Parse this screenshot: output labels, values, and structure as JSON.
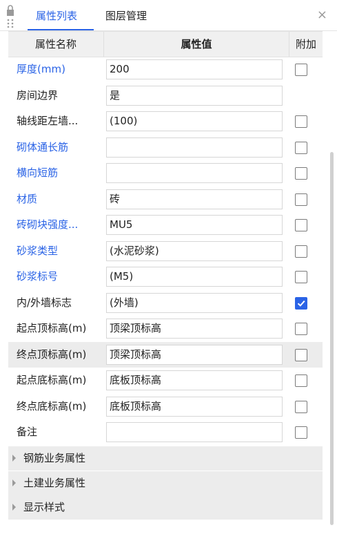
{
  "tabs": {
    "active": "属性列表",
    "inactive": "图层管理",
    "close": "×"
  },
  "header": {
    "name": "属性名称",
    "value": "属性值",
    "extra": "附加"
  },
  "rows": [
    {
      "name": "厚度(mm)",
      "value": "200",
      "blue": true,
      "checkbox": true,
      "checked": false
    },
    {
      "name": "房间边界",
      "value": "是",
      "blue": false,
      "checkbox": false,
      "checked": false
    },
    {
      "name": "轴线距左墙...",
      "value": "(100)",
      "blue": false,
      "checkbox": true,
      "checked": false
    },
    {
      "name": "砌体通长筋",
      "value": "",
      "blue": true,
      "checkbox": true,
      "checked": false
    },
    {
      "name": "横向短筋",
      "value": "",
      "blue": true,
      "checkbox": true,
      "checked": false
    },
    {
      "name": "材质",
      "value": "砖",
      "blue": true,
      "checkbox": true,
      "checked": false
    },
    {
      "name": "砖砌块强度...",
      "value": "MU5",
      "blue": true,
      "checkbox": true,
      "checked": false
    },
    {
      "name": "砂浆类型",
      "value": "(水泥砂浆)",
      "blue": true,
      "checkbox": true,
      "checked": false
    },
    {
      "name": "砂浆标号",
      "value": "(M5)",
      "blue": true,
      "checkbox": true,
      "checked": false
    },
    {
      "name": "内/外墙标志",
      "value": "(外墙)",
      "blue": false,
      "checkbox": true,
      "checked": true
    },
    {
      "name": "起点顶标高(m)",
      "value": "顶梁顶标高",
      "blue": false,
      "checkbox": true,
      "checked": false
    },
    {
      "name": "终点顶标高(m)",
      "value": "顶梁顶标高",
      "blue": false,
      "checkbox": true,
      "checked": false,
      "highlight": true
    },
    {
      "name": "起点底标高(m)",
      "value": "底板顶标高",
      "blue": false,
      "checkbox": true,
      "checked": false
    },
    {
      "name": "终点底标高(m)",
      "value": "底板顶标高",
      "blue": false,
      "checkbox": true,
      "checked": false
    },
    {
      "name": "备注",
      "value": "",
      "blue": false,
      "checkbox": true,
      "checked": false
    }
  ],
  "groups": [
    "钢筋业务属性",
    "土建业务属性",
    "显示样式"
  ],
  "colors": {
    "accent": "#2a63e6",
    "header_bg": "#f0f0f0",
    "group_bg": "#ececec"
  },
  "icons": {
    "lock": "lock-icon",
    "close": "close-icon",
    "expand": "triangle-right-icon",
    "check": "check-icon"
  }
}
